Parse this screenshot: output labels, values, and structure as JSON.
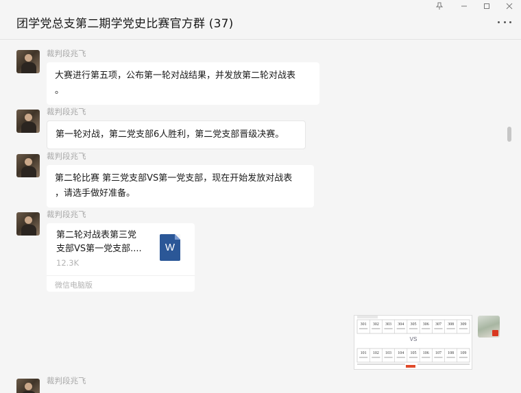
{
  "window": {
    "title": "团学党总支第二期学党史比赛官方群 (37)",
    "pin_icon": "pin-icon",
    "minimize_icon": "minimize-icon",
    "maximize_icon": "maximize-icon",
    "close_icon": "close-icon",
    "more_icon": "more-icon"
  },
  "messages": [
    {
      "sender": "裁判段兆飞",
      "text_lines": [
        "大赛进行第五项，公布第一轮对战结果，并发放第二轮对战表",
        "。"
      ]
    },
    {
      "sender": "裁判段兆飞",
      "text_lines": [
        "第一轮对战，第二党支部6人胜利，第二党支部晋级决赛。"
      ]
    },
    {
      "sender": "裁判段兆飞",
      "text_lines": [
        "第二轮比赛 第三党支部VS第一党支部，现在开始发放对战表",
        "，请选手做好准备。"
      ]
    },
    {
      "sender": "裁判段兆飞",
      "file": {
        "name_lines": [
          "第二轮对战表第三党",
          "支部VS第一党支部...."
        ],
        "size": "12.3K",
        "source": "微信电脑版",
        "icon_letter": "W"
      }
    },
    {
      "sender": "裁判段兆飞"
    }
  ],
  "thumbnail": {
    "top_row": [
      "301",
      "302",
      "303",
      "304",
      "305",
      "306",
      "307",
      "308",
      "309"
    ],
    "vs": "VS",
    "bottom_row": [
      "101",
      "102",
      "103",
      "104",
      "105",
      "106",
      "107",
      "108",
      "109"
    ]
  },
  "colors": {
    "background": "#f5f5f5",
    "bubble": "#ffffff",
    "word_blue": "#2b5797",
    "sender_gray": "#a8a8a8"
  }
}
